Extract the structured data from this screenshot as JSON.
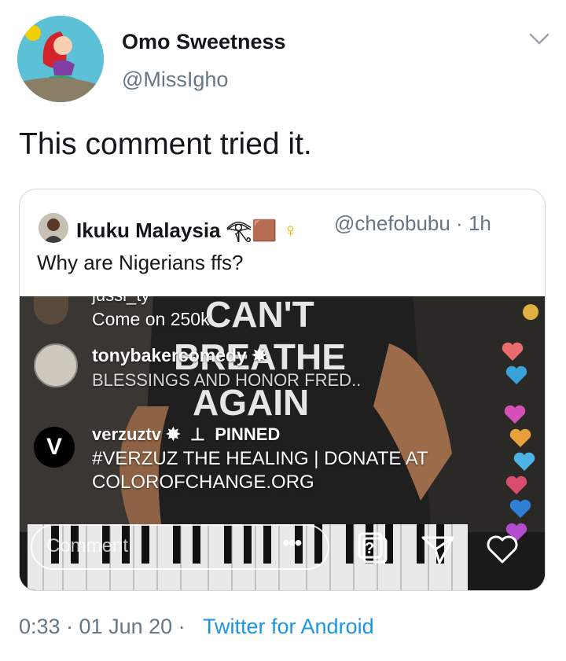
{
  "tweet": {
    "author_name": "Omo Sweetness",
    "author_handle": "@MissIgho",
    "text": "This comment tried it.",
    "timestamp": "0:33 · 01 Jun 20 · ",
    "source": "Twitter for Android"
  },
  "quoted": {
    "author_name": "Ikuku Malaysia 𓂀🟫",
    "author_symbol": "♀",
    "handle_time": "@chefobubu · 1h",
    "text": "Why are Nigerians ffs?"
  },
  "live_video": {
    "comments": [
      {
        "user": "jussi_ty",
        "text": "Come on 250k"
      },
      {
        "user": "tonybakercomedy",
        "text": "BLESSINGS AND HONOR FRED.."
      },
      {
        "user": "verzuztv",
        "badge": "PINNED",
        "text_line1": "#VERZUZ THE HEALING | DONATE AT",
        "text_line2": "COLOROFCHANGE.ORG"
      }
    ],
    "shirt_text": [
      "CAN'T",
      "BREATHE",
      "AGAIN"
    ],
    "comment_placeholder": "Comment",
    "avatar_letter": "V"
  }
}
